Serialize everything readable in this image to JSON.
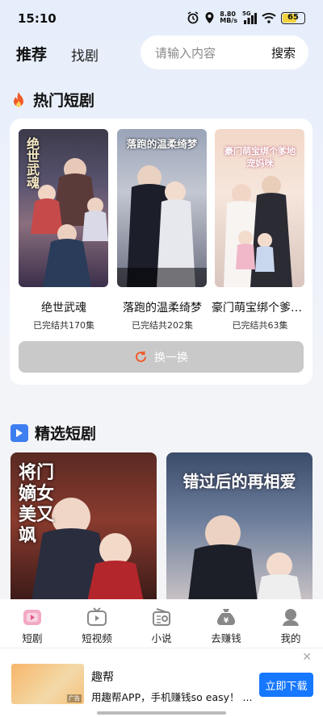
{
  "status": {
    "time": "15:10",
    "net_speed": "8.80",
    "net_unit": "MB/s",
    "net_type": "5G",
    "battery": "65"
  },
  "header": {
    "tab_recommend": "推荐",
    "tab_find": "找剧",
    "search_placeholder": "请输入内容",
    "search_button": "搜索"
  },
  "hot_section": {
    "title": "热门短剧",
    "items": [
      {
        "title": "绝世武魂",
        "status": "已完结共170集",
        "poster_text": "绝世武魂"
      },
      {
        "title": "落跑的温柔绮梦",
        "status": "已完结共202集",
        "poster_text": "落跑的温柔绮梦"
      },
      {
        "title": "豪门萌宝绑个爹地宠妈咪",
        "status": "已完结共63集",
        "poster_text": "豪门萌宝绑个爹地宠妈咪"
      }
    ],
    "refresh_button": "换一换"
  },
  "featured_section": {
    "title": "精选短剧",
    "items": [
      {
        "poster_text": "将门嫡女美又飒"
      },
      {
        "poster_text": "错过后的再相爱"
      }
    ]
  },
  "bottom_nav": [
    {
      "label": "短剧",
      "icon": "drama-icon"
    },
    {
      "label": "短视频",
      "icon": "video-icon"
    },
    {
      "label": "小说",
      "icon": "novel-icon"
    },
    {
      "label": "去赚钱",
      "icon": "money-bag-icon"
    },
    {
      "label": "我的",
      "icon": "profile-icon"
    }
  ],
  "ad": {
    "title": "趣帮",
    "description": "用趣帮APP，手机赚钱so easy！ ...",
    "button": "立即下载",
    "thumb_tag": "广告"
  },
  "colors": {
    "accent_blue": "#1677ff",
    "fire_orange": "#f05a28",
    "refresh_grey": "#c9c9c9"
  }
}
